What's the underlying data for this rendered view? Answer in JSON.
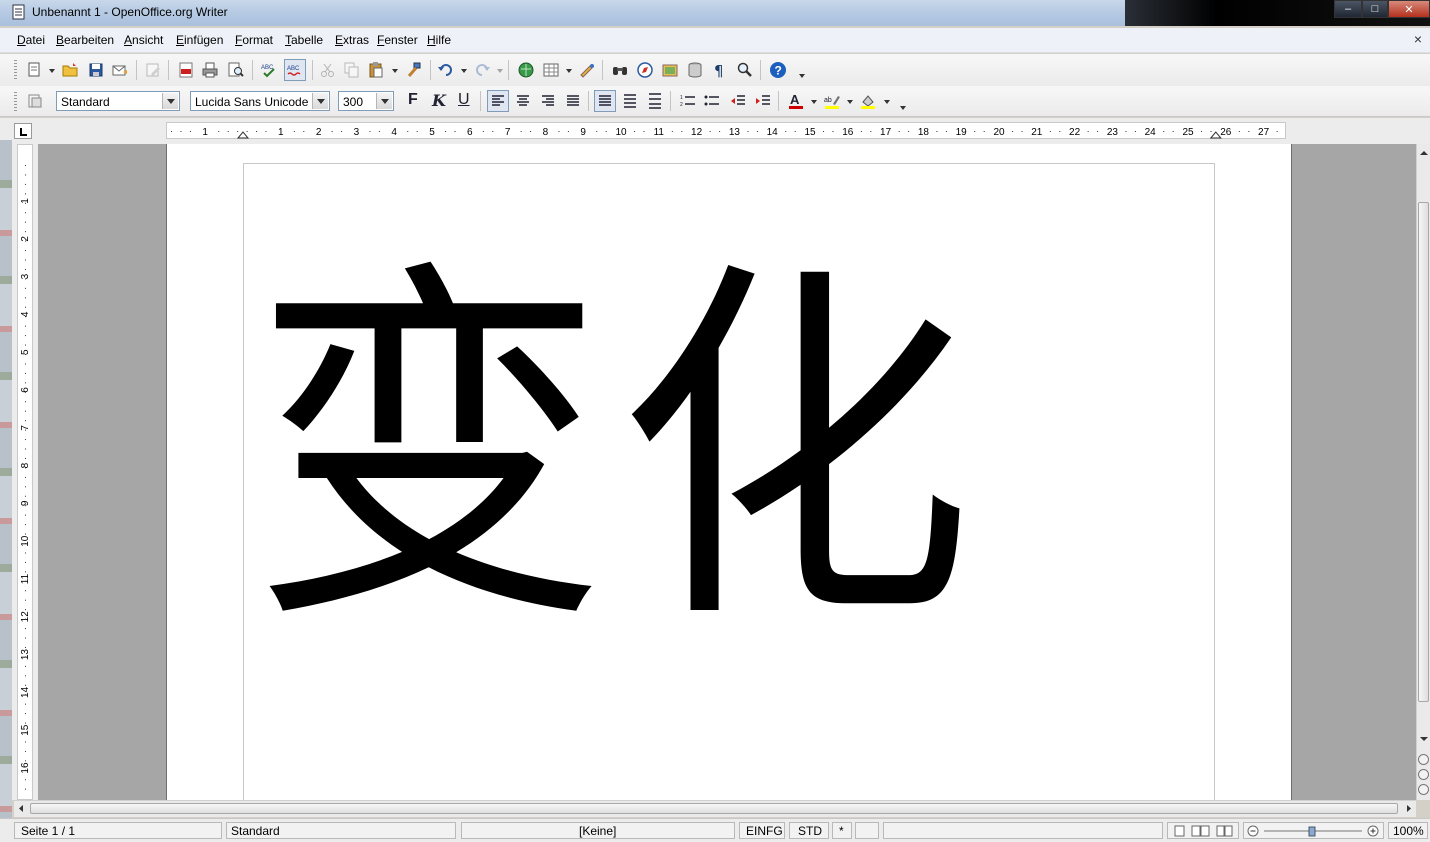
{
  "window": {
    "title": "Unbenannt 1 - OpenOffice.org Writer",
    "controls": {
      "minimize": "‒",
      "maximize": "□",
      "close": "✕"
    }
  },
  "menu": {
    "items": [
      "Datei",
      "Bearbeiten",
      "Ansicht",
      "Einfügen",
      "Format",
      "Tabelle",
      "Extras",
      "Fenster",
      "Hilfe"
    ],
    "close_document": "×"
  },
  "format_toolbar": {
    "paragraph_style": "Standard",
    "font_name": "Lucida Sans Unicode",
    "font_size": "300",
    "bold_label": "F",
    "italic_label": "K",
    "underline_label": "U"
  },
  "ruler": {
    "labels": [
      "1",
      "1",
      "2",
      "3",
      "4",
      "5",
      "6",
      "7",
      "8",
      "9",
      "10",
      "11",
      "12",
      "13",
      "14",
      "15",
      "16",
      "17",
      "18",
      "19",
      "20",
      "21",
      "22",
      "23",
      "24",
      "25",
      "26",
      "27"
    ],
    "vertical_labels": [
      "1",
      "2",
      "3",
      "4",
      "5",
      "6",
      "7",
      "8",
      "9",
      "10",
      "11",
      "12",
      "13",
      "14",
      "15",
      "16"
    ]
  },
  "document": {
    "text": "变化"
  },
  "statusbar": {
    "page": "Seite 1 / 1",
    "page_style": "Standard",
    "language": "[Keine]",
    "insert_mode": "EINFG",
    "selection_mode": "STD",
    "modified": "*",
    "zoom": "100%"
  },
  "colors": {
    "font_color": "#cc0000",
    "highlight_color": "#ffff00",
    "help_icon": "#1d5fbf"
  }
}
